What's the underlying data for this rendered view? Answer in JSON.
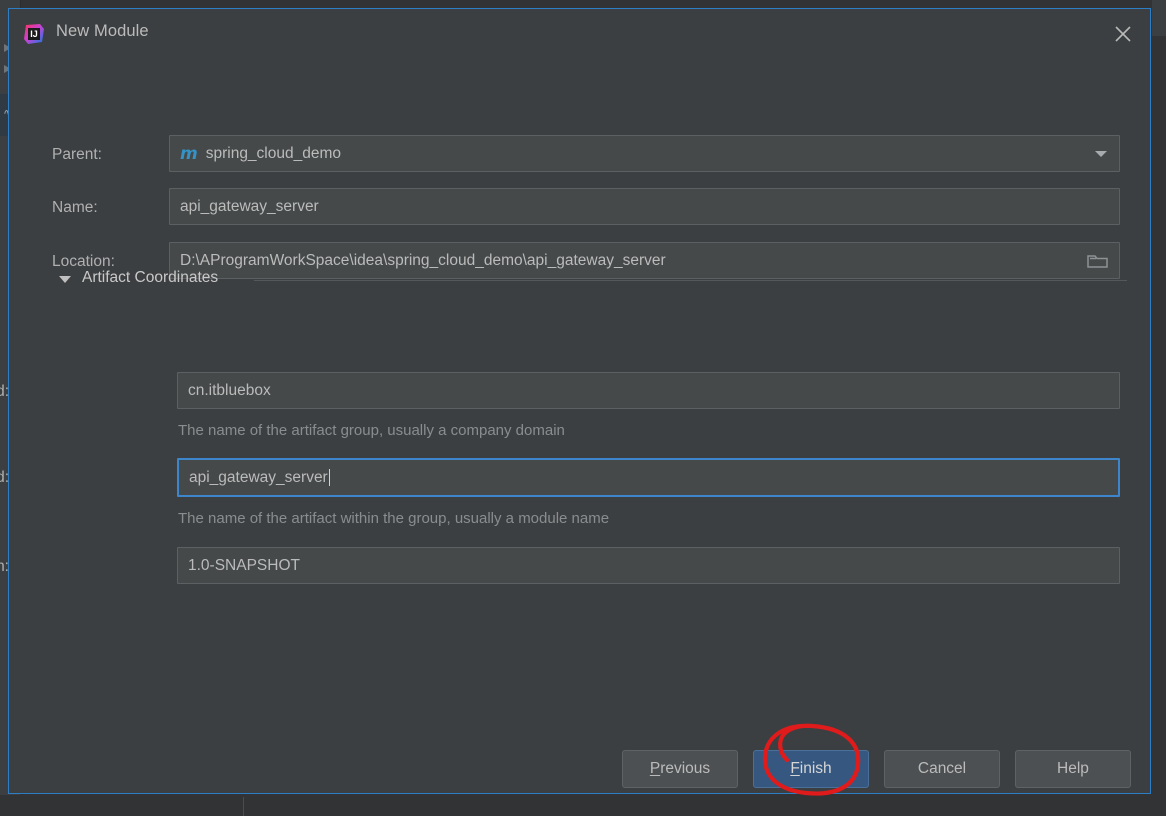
{
  "window": {
    "title": "New Module",
    "app_icon": "intellij-idea-icon",
    "close_icon": "close-icon",
    "border_color": "#2d7ec4"
  },
  "theme": {
    "dialog_bg": "#3C3F41",
    "field_bg": "#45494A",
    "text": "#bbbbbb",
    "hint_text": "#8a8d8f",
    "accent_blue": "#365880",
    "focus_blue": "#3d86cc",
    "maven_icon_color": "#3592c4",
    "annotation_red": "#e01b1b"
  },
  "form": {
    "parent": {
      "label": "Parent:",
      "value": "spring_cloud_demo",
      "icon": "maven-module-icon",
      "dropdown_icon": "chevron-down-icon"
    },
    "name": {
      "label": "Name:",
      "value": "api_gateway_server"
    },
    "location": {
      "label": "Location:",
      "value": "D:\\AProgramWorkSpace\\idea\\spring_cloud_demo\\api_gateway_server",
      "browse_icon": "folder-icon"
    }
  },
  "artifact_section": {
    "title": "Artifact Coordinates",
    "expanded": true,
    "collapse_icon": "triangle-down-icon",
    "group_id": {
      "label": "GroupId:",
      "value": "cn.itbluebox",
      "hint": "The name of the artifact group, usually a company domain"
    },
    "artifact_id": {
      "label": "ArtifactId:",
      "value": "api_gateway_server",
      "hint": "The name of the artifact within the group, usually a module name",
      "focused": true
    },
    "version": {
      "label": "Version:",
      "value": "1.0-SNAPSHOT"
    }
  },
  "buttons": {
    "previous": {
      "label": "Previous",
      "mnemonic": "P"
    },
    "finish": {
      "label": "Finish",
      "mnemonic": "F",
      "primary": true,
      "annotated": true
    },
    "cancel": {
      "label": "Cancel"
    },
    "help": {
      "label": "Help"
    }
  },
  "annotation": {
    "shape": "hand-drawn-red-ellipse",
    "target": "finish-button"
  }
}
